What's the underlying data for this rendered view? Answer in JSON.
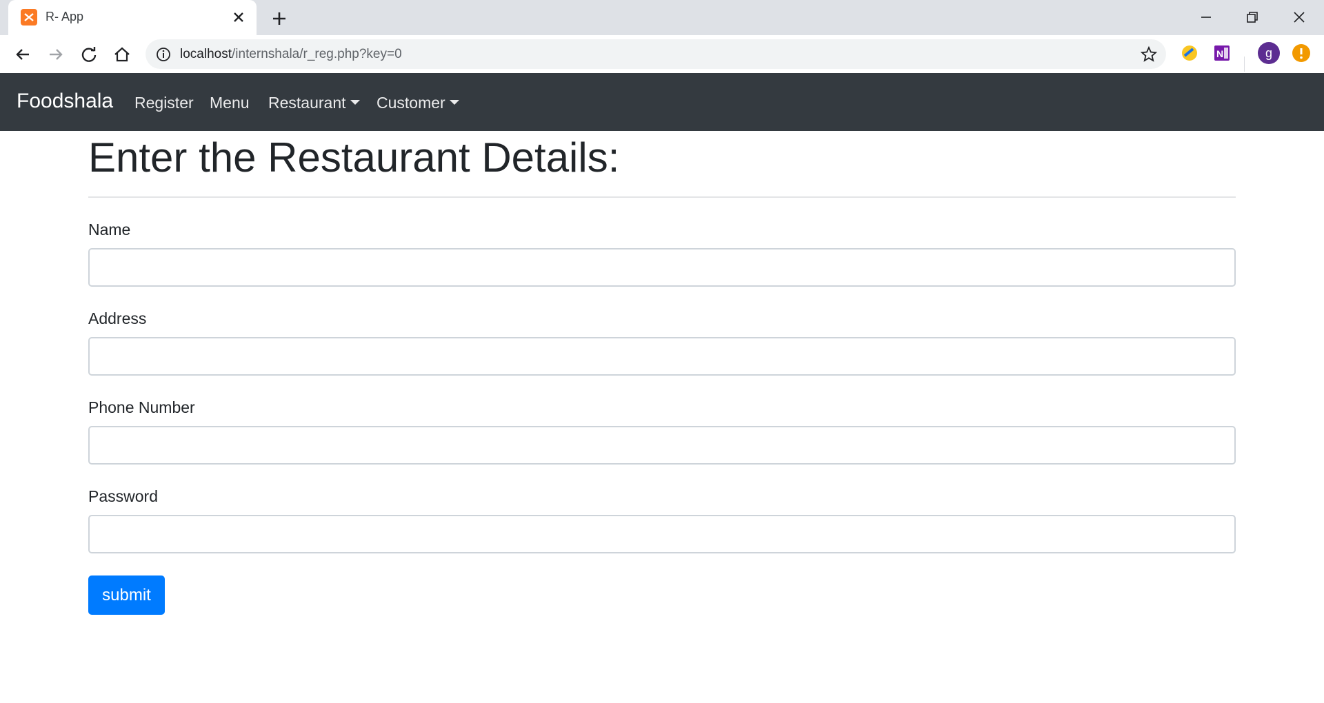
{
  "browser": {
    "tab_title": "R- App",
    "url_host": "localhost",
    "url_path": "/internshala/r_reg.php?key=0",
    "profile_initial": "g"
  },
  "navbar": {
    "brand": "Foodshala",
    "links": [
      "Register",
      "Menu"
    ],
    "dropdowns": [
      "Restaurant",
      "Customer"
    ]
  },
  "form": {
    "title": "Enter the Restaurant Details:",
    "fields": [
      {
        "label": "Name",
        "value": ""
      },
      {
        "label": "Address",
        "value": ""
      },
      {
        "label": "Phone Number",
        "value": ""
      },
      {
        "label": "Password",
        "value": ""
      }
    ],
    "submit_label": "submit"
  },
  "colors": {
    "navbar_bg": "#343a40",
    "primary": "#007bff",
    "tab_strip": "#dee1e6"
  },
  "icons": [
    "app-favicon-icon",
    "close-icon",
    "plus-icon",
    "minimize-icon",
    "restore-icon",
    "back-arrow-icon",
    "forward-arrow-icon",
    "reload-icon",
    "home-icon",
    "info-icon",
    "star-icon",
    "extension-pencil-icon",
    "onenote-icon",
    "profile-avatar-icon",
    "alert-icon"
  ]
}
